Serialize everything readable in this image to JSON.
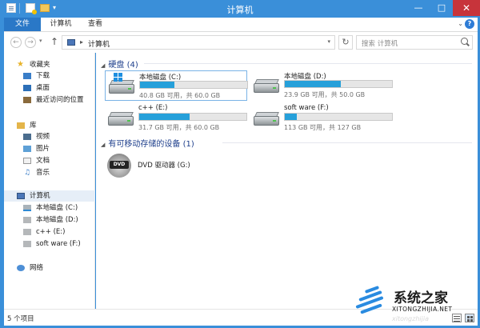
{
  "window": {
    "title": "计算机",
    "min_label": "—",
    "max_label": "□",
    "close_label": "✕"
  },
  "ribbon": {
    "tabs": [
      "文件",
      "计算机",
      "查看"
    ]
  },
  "address": {
    "path": "计算机",
    "search_placeholder": "搜索 计算机"
  },
  "nav": {
    "favorites": "收藏夹",
    "fav_items": [
      "下载",
      "桌面",
      "最近访问的位置"
    ],
    "libraries": "库",
    "lib_items": [
      "视频",
      "图片",
      "文档",
      "音乐"
    ],
    "computer": "计算机",
    "drives": [
      "本地磁盘 (C:)",
      "本地磁盘 (D:)",
      "c++ (E:)",
      "soft ware (F:)"
    ],
    "network": "网络"
  },
  "content": {
    "hdd_group": "硬盘 (4)",
    "removable_group": "有可移动存储的设备 (1)",
    "drives": [
      {
        "name": "本地磁盘 (C:)",
        "info": "40.8 GB 可用，共 60.0 GB",
        "used_fraction": 0.32,
        "system": true
      },
      {
        "name": "本地磁盘 (D:)",
        "info": "23.9 GB 可用，共 50.0 GB",
        "used_fraction": 0.52,
        "system": false
      },
      {
        "name": "c++ (E:)",
        "info": "31.7 GB 可用，共 60.0 GB",
        "used_fraction": 0.47,
        "system": false
      },
      {
        "name": "soft ware (F:)",
        "info": "113 GB 可用，共 127 GB",
        "used_fraction": 0.11,
        "system": false
      }
    ],
    "dvd": {
      "name": "DVD 驱动器 (G:)",
      "label": "DVD"
    }
  },
  "status": {
    "count": "5 个项目"
  },
  "watermark": {
    "brand": "系统之家",
    "url": "XITONGZHIJIA.NET",
    "faint": "xitongzhijia"
  },
  "colors": {
    "accent": "#3a8fd9",
    "file_tab": "#2a78c7",
    "bar_fill": "#26a0da",
    "group_header": "#1e3f8c",
    "close": "#c7343b"
  },
  "icons": [
    "properties-icon",
    "new-document-icon",
    "new-folder-icon",
    "back-icon",
    "forward-icon",
    "up-icon",
    "computer-icon",
    "refresh-icon",
    "search-icon",
    "help-icon",
    "star-icon",
    "download-icon",
    "desktop-icon",
    "recent-icon",
    "library-icon",
    "video-icon",
    "picture-icon",
    "document-icon",
    "music-icon",
    "drive-icon",
    "network-icon",
    "dvd-icon",
    "details-view-icon",
    "tiles-view-icon"
  ]
}
